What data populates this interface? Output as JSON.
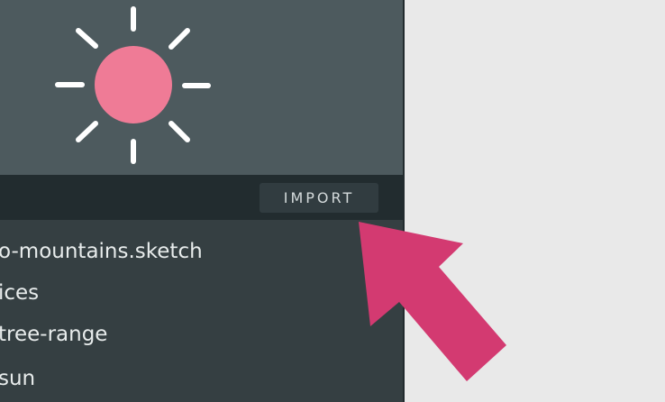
{
  "toolbar": {
    "import_label": "IMPORT"
  },
  "layers": [
    {
      "label": "o-mountains.sketch"
    },
    {
      "label": "ices"
    },
    {
      "label": "tree-range"
    },
    {
      "label": "sun"
    }
  ],
  "preview": {
    "icon": "sun-icon",
    "sun_color": "#ef7b96",
    "ray_color": "#ffffff"
  },
  "annotation": {
    "icon": "arrow-pointer-icon",
    "color": "#d33a71"
  }
}
